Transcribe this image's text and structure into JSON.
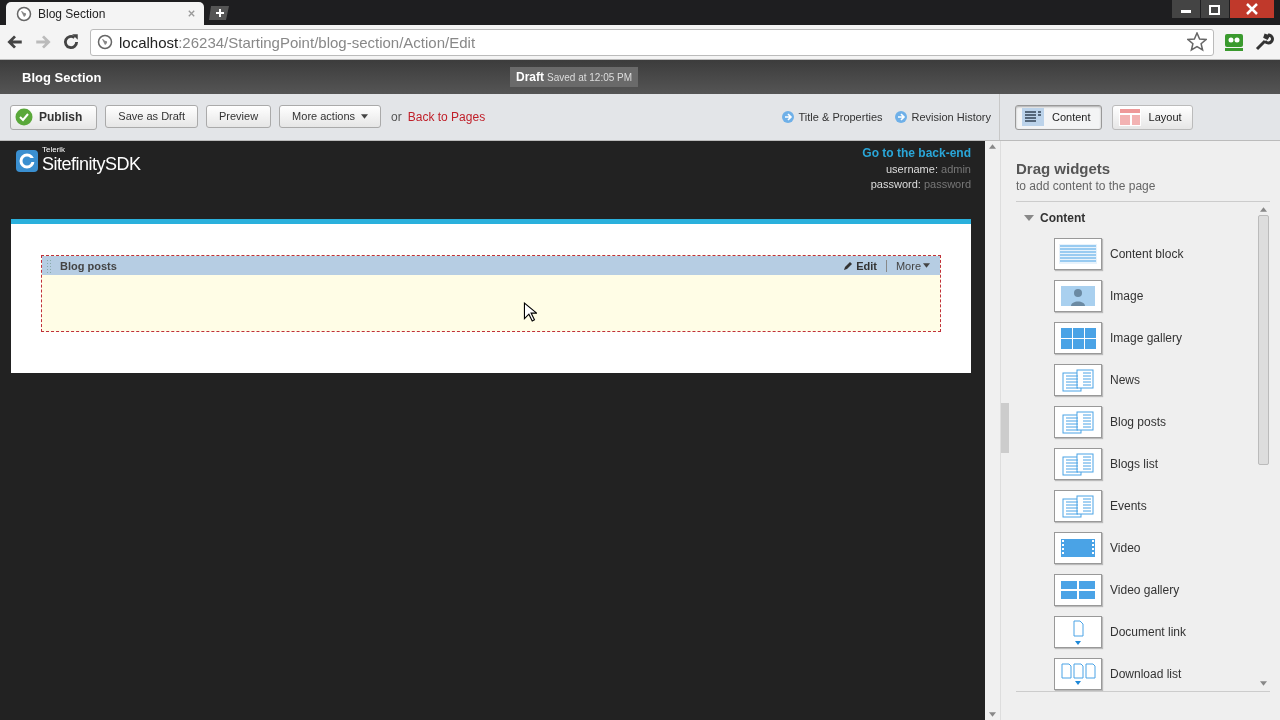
{
  "browser": {
    "tab_title": "Blog Section",
    "address_host": "localhost",
    "address_path": ":26234/StartingPoint/blog-section/Action/Edit"
  },
  "header": {
    "title": "Blog Section",
    "status": "Draft",
    "saved": "Saved at 12:05 PM"
  },
  "toolbar": {
    "buttons": [
      {
        "label": "Publish",
        "kind": "primary"
      },
      {
        "label": "Save as Draft",
        "kind": "plain"
      },
      {
        "label": "Preview",
        "kind": "plain"
      },
      {
        "label": "More actions",
        "kind": "menu"
      }
    ],
    "or_text": "or",
    "back_link": "Back to Pages",
    "links": [
      "Title & Properties",
      "Revision History"
    ]
  },
  "mode_tabs": [
    {
      "label": "Content",
      "kind": "content",
      "selected": true
    },
    {
      "label": "Layout",
      "kind": "layout",
      "selected": false
    }
  ],
  "site": {
    "logo_small": "Telerik",
    "logo_name": "Sitefinity",
    "logo_suffix": "SDK",
    "backend_link": "Go to the back-end",
    "username_label": "username:",
    "username": "admin",
    "password_label": "password:",
    "password": "password"
  },
  "widget": {
    "title": "Blog posts",
    "edit": "Edit",
    "more": "More"
  },
  "panel": {
    "title": "Drag widgets",
    "subtitle": "to add content to the page",
    "section": {
      "label": "Content",
      "expanded": true
    },
    "widgets": [
      {
        "label": "Content block",
        "kind": "lines"
      },
      {
        "label": "Image",
        "kind": "image"
      },
      {
        "label": "Image gallery",
        "kind": "grid"
      },
      {
        "label": "News",
        "kind": "list"
      },
      {
        "label": "Blog posts",
        "kind": "list"
      },
      {
        "label": "Blogs list",
        "kind": "list"
      },
      {
        "label": "Events",
        "kind": "list"
      },
      {
        "label": "Video",
        "kind": "video"
      },
      {
        "label": "Video gallery",
        "kind": "videos"
      },
      {
        "label": "Document link",
        "kind": "doc"
      },
      {
        "label": "Download list",
        "kind": "docs"
      }
    ]
  }
}
